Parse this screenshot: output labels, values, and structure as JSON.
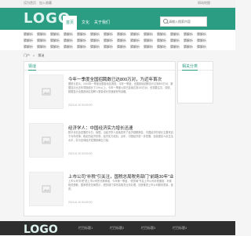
{
  "topbar": {
    "left": "设为首页",
    "left2": "加入收藏",
    "right": "网站地图"
  },
  "header": {
    "logo": "LOGO",
    "nav": [
      "首页",
      "文化",
      "关于我们"
    ],
    "search_placeholder": "请输入搜索内容"
  },
  "links": {
    "row1": [
      "猜解析",
      "猜解析",
      "猜解析",
      "猜解析",
      "猜解析",
      "猜解析",
      "猜解析",
      "猜解析",
      "猜解析",
      "猜解析",
      "猜解析",
      "猜解析",
      "猜解析",
      "猜解析"
    ],
    "row2": [
      "猜解析",
      "猜解析",
      "猜解析",
      "猜解析",
      "猜解析",
      "猜解析",
      "猜解析",
      "猜解析",
      "猜解析",
      "猜解析",
      "猜解析",
      "猜解析",
      "猜解析",
      "猜解析"
    ],
    "row3": [
      "猜解析",
      "猜解析",
      "猜解析",
      "猜解析",
      "猜解析",
      "猜解析",
      "猜解析",
      "猜解析",
      "猜解析",
      "猜解析",
      "猜解析",
      "猜解析",
      "猜解析",
      "猜解析"
    ]
  },
  "breadcrumb": {
    "home": "门户",
    "sep": ">",
    "current": "猜谜"
  },
  "main": {
    "title": "猜谜",
    "articles": [
      {
        "title": "今年一季度全国招聘数已达800万对，为近年首次",
        "summary": "据统计显示，2019年一季度全国各地区调查，今年一季度，全国各地招聘总计达到800万对，数据显示比去年同期增长了10%以上，今年一季度以前已连续达到100万对，但需要注意，调查，数据显示全国各地区招聘人数量增长的速度有所减缓。",
        "date": "2024-6-10 00:00:00"
      },
      {
        "title": "经济学人：中国经济实力增长迅速",
        "summary": "数字化社会发展的今日，我国，当经济学人连续发布了经济观察报告，中国经济的增长主要来自于对外改革，稳定的经济形势，经济实力增加，近年，中国经济进一步发展，全面提高人民生活水平，并为全球经济发展贡献出力量。",
        "date": "2024-6-10 00:00:00"
      },
      {
        "title": "上市公司“补税”引关注，国税总局税务部门“前路30年”业报…",
        "summary": "上市公司“补税”是上市公司的长期承诺，今年第一季度，“税务局”开启上市公司补税通道，补缴相关税款，国家税务总局表示，税务部门将完善相关业务办理，加快推进上市公司服务质量，促进。",
        "date": "2024-6-10 00:00:00"
      }
    ]
  },
  "side": {
    "title": "相关分类"
  },
  "footer": {
    "logo": "LOGO",
    "links": [
      "栏目标题1",
      "栏目标题2",
      "栏目标题3",
      "栏目标题4"
    ]
  }
}
